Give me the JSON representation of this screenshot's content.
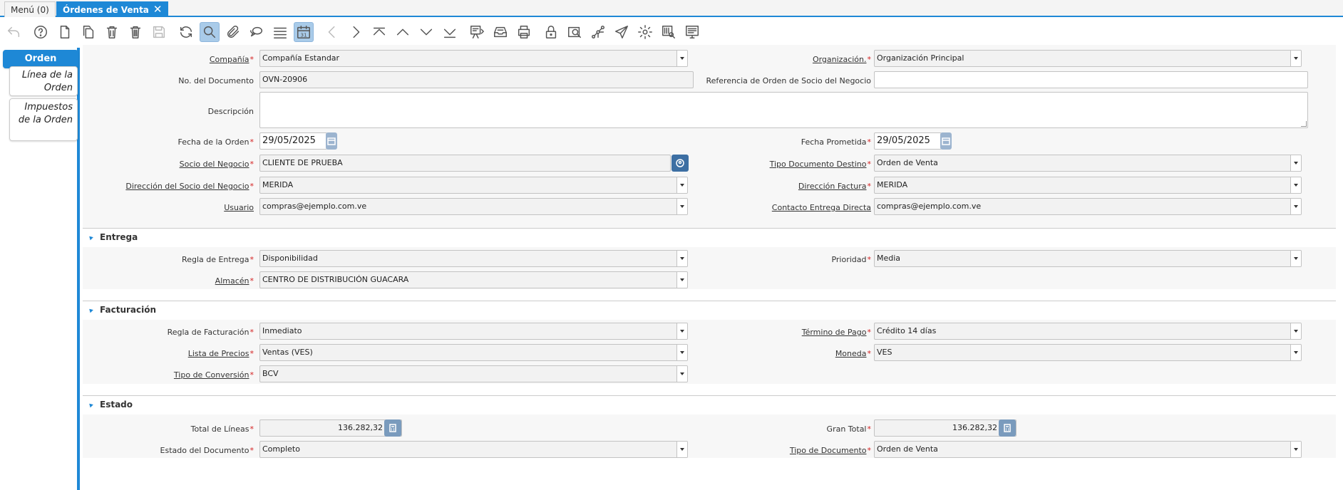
{
  "window_tabs": {
    "menu": "Menú (0)",
    "active": "Órdenes de Venta"
  },
  "toolbar_icons": [
    "undo-icon",
    "help-icon",
    "new-record-icon",
    "copy-record-icon",
    "delete-icon",
    "delete-selection-icon",
    "save-icon",
    "refresh-icon",
    "find-icon",
    "attachment-icon",
    "chat-icon",
    "grid-toggle-icon",
    "calendar-icon",
    "previous-icon",
    "next-icon",
    "first-record-icon",
    "parent-record-icon",
    "detail-record-icon",
    "last-record-icon",
    "report-icon",
    "archive-icon",
    "print-icon",
    "lock-icon",
    "zoom-across-icon",
    "workflow-icon",
    "send-icon",
    "process-icon",
    "product-info-icon",
    "customize-icon"
  ],
  "left_tabs": [
    "Orden",
    "Línea de la Orden",
    "Impuestos de la Orden"
  ],
  "header": {
    "compania": {
      "label": "Compañía",
      "value": "Compañía Estandar"
    },
    "organizacion": {
      "label": "Organización.",
      "value": "Organización Principal"
    },
    "no_documento": {
      "label": "No. del Documento",
      "value": "OVN-20906"
    },
    "referencia": {
      "label": "Referencia de Orden de Socio del Negocio",
      "value": ""
    },
    "descripcion": {
      "label": "Descripción",
      "value": ""
    },
    "fecha_orden": {
      "label": "Fecha de la Orden",
      "value": "29/05/2025"
    },
    "fecha_prometida": {
      "label": "Fecha Prometida",
      "value": "29/05/2025"
    },
    "socio": {
      "label": "Socio del Negocio",
      "value": "CLIENTE DE PRUEBA"
    },
    "tipo_doc_destino": {
      "label": "Tipo Documento Destino",
      "value": "Orden de Venta"
    },
    "direccion_socio": {
      "label": "Dirección del Socio del Negocio",
      "value": "MERIDA"
    },
    "direccion_factura": {
      "label": "Dirección Factura",
      "value": "MERIDA"
    },
    "usuario": {
      "label": "Usuario",
      "value": "compras@ejemplo.com.ve"
    },
    "contacto_entrega": {
      "label": "Contacto Entrega Directa",
      "value": "compras@ejemplo.com.ve"
    }
  },
  "entrega": {
    "title": "Entrega",
    "regla": {
      "label": "Regla de Entrega",
      "value": "Disponibilidad"
    },
    "prioridad": {
      "label": "Prioridad",
      "value": "Media"
    },
    "almacen": {
      "label": "Almacén",
      "value": "CENTRO DE DISTRIBUCIÓN GUACARA"
    }
  },
  "facturacion": {
    "title": "Facturación",
    "regla": {
      "label": "Regla de Facturación",
      "value": "Inmediato"
    },
    "termino": {
      "label": "Término de Pago",
      "value": "Crédito 14 días"
    },
    "lista": {
      "label": "Lista de Precios",
      "value": "Ventas (VES)"
    },
    "moneda": {
      "label": "Moneda",
      "value": "VES"
    },
    "conversion": {
      "label": "Tipo de Conversión",
      "value": "BCV"
    }
  },
  "estado": {
    "title": "Estado",
    "total_lineas": {
      "label": "Total de Líneas",
      "value": "136.282,32"
    },
    "gran_total": {
      "label": "Gran Total",
      "value": "136.282,32"
    },
    "estado_doc": {
      "label": "Estado del Documento",
      "value": "Completo"
    },
    "tipo_doc": {
      "label": "Tipo de Documento",
      "value": "Orden de Venta"
    }
  },
  "colors": {
    "accent": "#1e88d6",
    "required": "#d42020"
  }
}
